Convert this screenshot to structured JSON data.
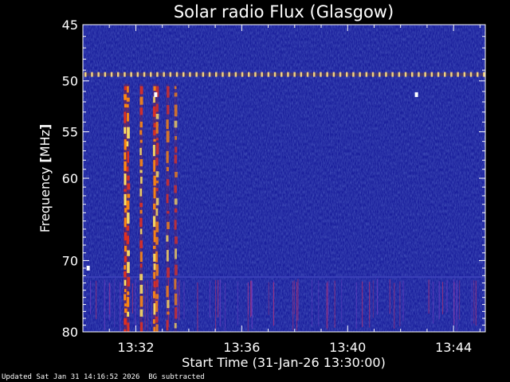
{
  "chart_data": {
    "type": "heatmap",
    "title": "Solar radio Flux (Glasgow)",
    "xlabel": "Start Time (31-Jan-26 13:30:00)",
    "ylabel_text": "Frequency ",
    "ylabel_unit": "MHz",
    "x_unit": "minutes after 13:30",
    "xlim": [
      0,
      15.2
    ],
    "x_ticks": [
      {
        "value": 2,
        "label": "13:32"
      },
      {
        "value": 6,
        "label": "13:36"
      },
      {
        "value": 10,
        "label": "13:40"
      },
      {
        "value": 14,
        "label": "13:44"
      }
    ],
    "ylim": [
      45,
      80
    ],
    "y_scale": "log",
    "y_ticks": [
      {
        "value": 45,
        "label": "45"
      },
      {
        "value": 50,
        "label": "50"
      },
      {
        "value": 55,
        "label": "55"
      },
      {
        "value": 60,
        "label": "60"
      },
      {
        "value": 70,
        "label": "70"
      },
      {
        "value": 80,
        "label": "80"
      }
    ],
    "background_color": "#1a1f9c",
    "burst_color": "#ff8a10",
    "interference_color": "#f2d080",
    "bright_band_frequency": 49.4,
    "weak_band_frequency": 72.2,
    "burst_lanes": [
      {
        "time": 1.6,
        "intensity": 1.0
      },
      {
        "time": 1.7,
        "intensity": 0.9
      },
      {
        "time": 2.2,
        "intensity": 0.75
      },
      {
        "time": 2.7,
        "intensity": 0.85
      },
      {
        "time": 2.8,
        "intensity": 0.6
      },
      {
        "time": 3.2,
        "intensity": 0.55
      },
      {
        "time": 3.5,
        "intensity": 0.45
      }
    ],
    "spots": [
      {
        "time": 2.75,
        "frequency": 51.3
      },
      {
        "time": 12.6,
        "frequency": 51.3
      },
      {
        "time": 0.2,
        "frequency": 71.0
      }
    ]
  },
  "footer": {
    "updated": "Updated Sat Jan 31 14:16:52 2026",
    "note": "BG subtracted"
  },
  "colors": {
    "background": "#000000",
    "text": "#ffffff"
  }
}
